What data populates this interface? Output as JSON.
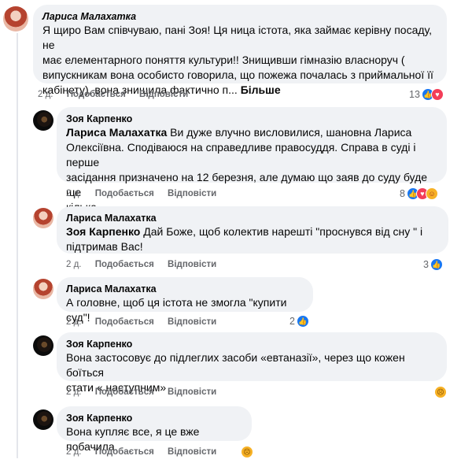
{
  "actions": {
    "like": "Подобається",
    "reply": "Відповісти"
  },
  "comments": [
    {
      "author": "Лариса Малахатка",
      "author_italic": true,
      "mention": "",
      "lines": [
        "Я щиро Вам співчуваю, пані Зоя! Ця ница істота, яка займає керівну посаду, не",
        "має елементарного поняття культури!! Знищивши гімназію власноруч (",
        "випускникам вона особисто говорила, що пожежа почалась з приймальної її",
        "кабінету), вона знищила фактично п... "
      ],
      "more": "Більше",
      "time": "2 д.",
      "reaction_count": "13",
      "reactions": [
        "like-icon",
        "love-icon"
      ]
    },
    {
      "author": "Зоя Карпенко",
      "mention": "Лариса Малахатка",
      "lines": [
        " Ви дуже влучно висловилися, шановна Лариса",
        "Олексіївна. Сподіваюся на справедливе правосуддя. Справа в суді і перше",
        "засідання призначено на 12 березня, але думаю що заяв до суду буде ще",
        "кілька."
      ],
      "time": "2 д.",
      "reaction_count": "8",
      "reactions": [
        "like-icon",
        "love-icon",
        "care-icon"
      ]
    },
    {
      "author": "Лариса Малахатка",
      "mention": "Зоя Карпенко",
      "lines": [
        " Дай Боже, щоб колектив нарешті \"проснувся від сну \" і",
        "підтримав Вас!"
      ],
      "time": "2 д.",
      "reaction_count": "3",
      "reactions": [
        "like-icon"
      ]
    },
    {
      "author": "Лариса Малахатка",
      "mention": "",
      "lines": [
        "А головне, щоб ця істота не змогла \"купити суд\"!"
      ],
      "time": "2 д.",
      "reaction_count": "2",
      "reactions": [
        "like-icon"
      ]
    },
    {
      "author": "Зоя Карпенко",
      "mention": "",
      "lines": [
        "Вона застосовує до підлеглих засоби «евтаназії», через що кожен боїться",
        "стати « наступним»"
      ],
      "time": "2 д.",
      "reaction_count": "",
      "reactions": [
        "sad-icon"
      ]
    },
    {
      "author": "Зоя Карпенко",
      "mention": "",
      "lines": [
        "Вона купляє все, я це вже побачила."
      ],
      "time": "2 д.",
      "reaction_count": "",
      "reactions": [
        "sad-icon"
      ]
    }
  ]
}
